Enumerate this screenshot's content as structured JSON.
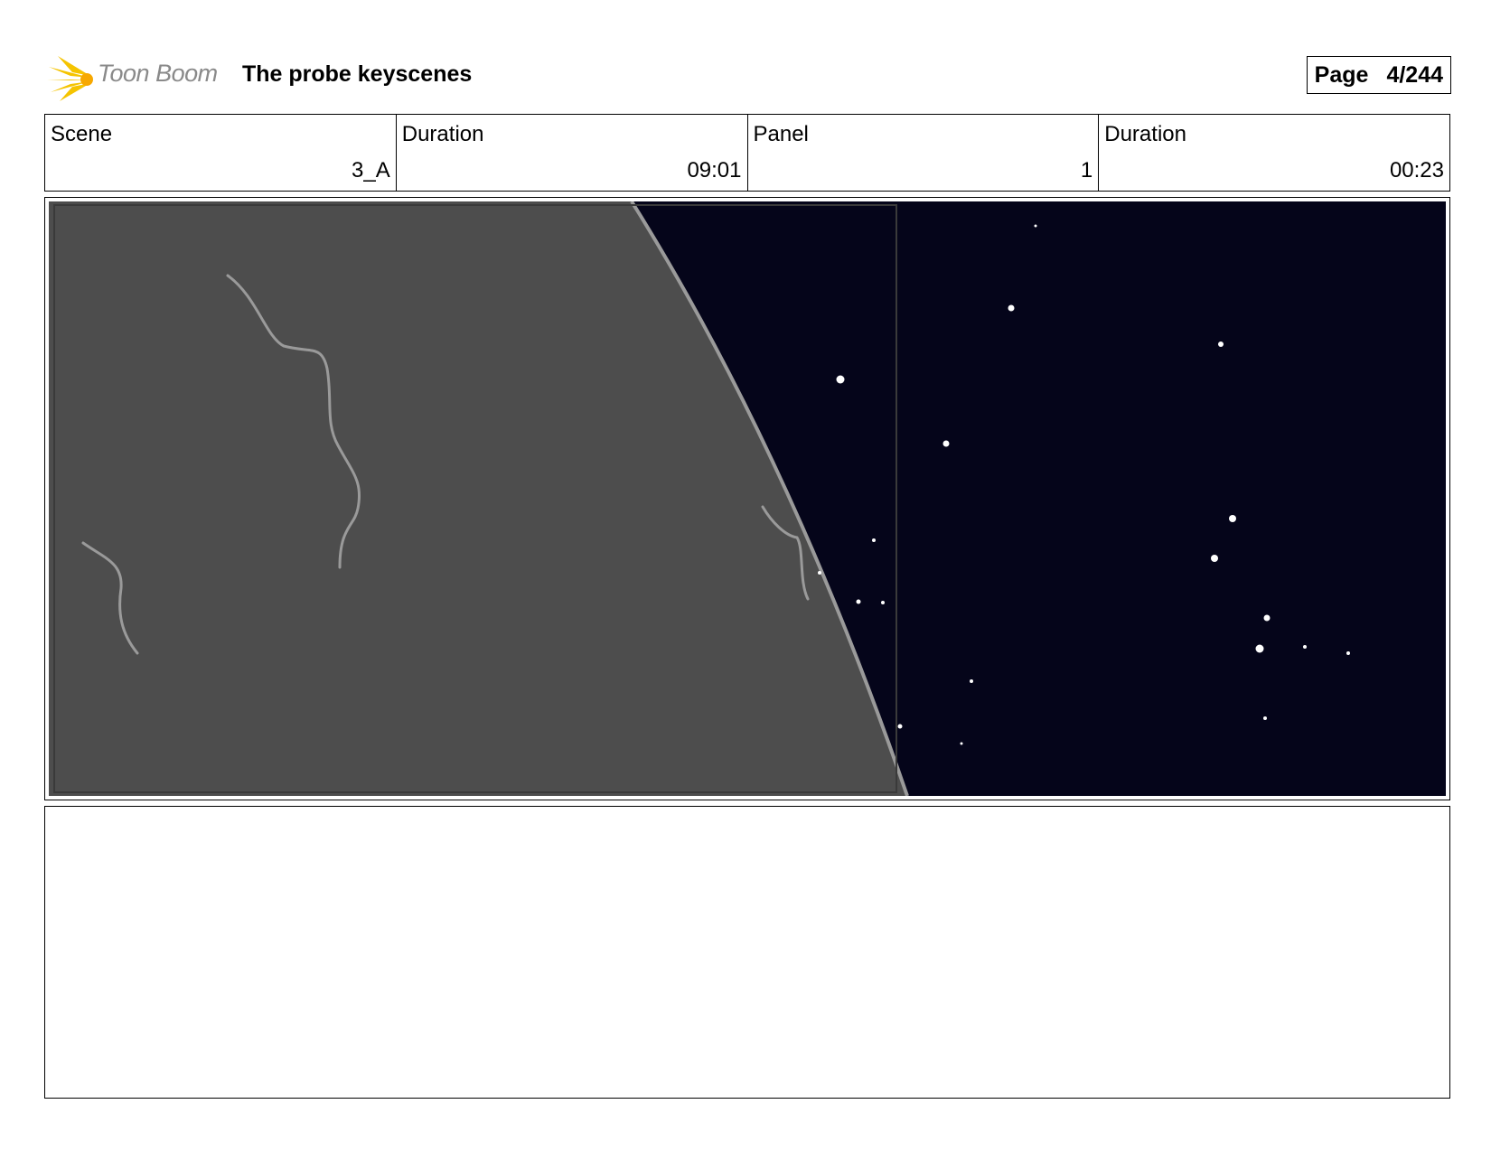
{
  "header": {
    "logo_text": "Toon Boom",
    "title": "The probe keyscenes",
    "page_label": "Page",
    "page_value": "4/244"
  },
  "info": {
    "scene_label": "Scene",
    "scene_value": "3_A",
    "scene_duration_label": "Duration",
    "scene_duration_value": "09:01",
    "panel_label": "Panel",
    "panel_value": "1",
    "panel_duration_label": "Duration",
    "panel_duration_value": "00:23"
  },
  "colors": {
    "planet": "#4d4d4d",
    "space": "#05051a",
    "rim": "#9a9a9a",
    "logo_yellow": "#f5c400"
  }
}
